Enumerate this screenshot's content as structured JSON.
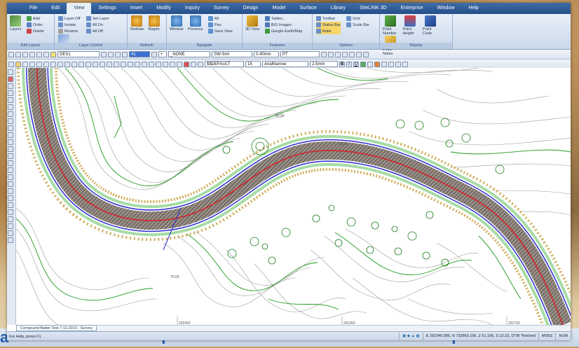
{
  "menu": {
    "items": [
      "File",
      "Edit",
      "View",
      "Settings",
      "Insert",
      "Modify",
      "Inquiry",
      "Survey",
      "Design",
      "Model",
      "Surface",
      "Library",
      "SiteLINK 3D",
      "Enterprise",
      "Window",
      "Help"
    ],
    "active_index": 2
  },
  "ribbon": {
    "groups": [
      {
        "label": "Edit Layers",
        "big": [
          {
            "label": "Layers",
            "icon": "layers-icon"
          }
        ],
        "small": [
          {
            "label": "Add",
            "icon": "add-icon"
          },
          {
            "label": "Order",
            "icon": "order-icon"
          },
          {
            "label": "Delete",
            "icon": "delete-icon"
          }
        ]
      },
      {
        "label": "Layer Control",
        "small": [
          {
            "label": "Layer Off",
            "icon": "layer-off-icon"
          },
          {
            "label": "Isolate",
            "icon": "isolate-icon"
          },
          {
            "label": "Restore",
            "icon": "restore-icon"
          }
        ],
        "small2": [
          {
            "label": "Set Layer",
            "icon": "set-layer-icon"
          },
          {
            "label": "All On",
            "icon": "all-on-icon"
          },
          {
            "label": "All Off",
            "icon": "all-off-icon"
          }
        ],
        "big": [
          {
            "label": "Groups",
            "icon": "groups-icon"
          }
        ]
      },
      {
        "label": "Refresh",
        "big": [
          {
            "label": "Redraw",
            "icon": "redraw-icon"
          },
          {
            "label": "Regen",
            "icon": "regen-icon"
          }
        ]
      },
      {
        "label": "Navigate",
        "big": [
          {
            "label": "Window",
            "icon": "window-icon"
          },
          {
            "label": "Previous",
            "icon": "previous-icon"
          }
        ],
        "small": [
          {
            "label": "All",
            "icon": "zoom-all-icon"
          },
          {
            "label": "Pan",
            "icon": "pan-icon"
          },
          {
            "label": "Save View",
            "icon": "save-view-icon"
          }
        ]
      },
      {
        "label": "Features",
        "big": [
          {
            "label": "3D View",
            "icon": "3d-view-icon"
          }
        ],
        "small": [
          {
            "label": "Tables...",
            "icon": "tables-icon"
          },
          {
            "label": "B/G Images",
            "icon": "bg-images-icon"
          },
          {
            "label": "Google Earth/Map",
            "icon": "google-earth-icon"
          }
        ]
      },
      {
        "label": "Options",
        "small": [
          {
            "label": "Toolbar",
            "icon": "toolbar-icon"
          },
          {
            "label": "Status Bar",
            "icon": "status-bar-icon"
          },
          {
            "label": "Ruler",
            "icon": "ruler-icon"
          }
        ],
        "small2": [
          {
            "label": "Grid",
            "icon": "grid-icon"
          },
          {
            "label": "Scale Bar",
            "icon": "scale-bar-icon"
          }
        ]
      },
      {
        "label": "Display",
        "big": [
          {
            "label": "Point Number",
            "icon": "point-number-icon"
          },
          {
            "label": "Point Height",
            "icon": "point-height-icon"
          },
          {
            "label": "Point Code",
            "icon": "point-code-icon"
          },
          {
            "label": "Point Notes",
            "icon": "point-notes-icon"
          }
        ]
      }
    ]
  },
  "toolbar1": {
    "layer_combo": "DES1",
    "number_combo": "41",
    "none_combo": "_NONE",
    "linetype_combo": "SW-Sml",
    "width_combo": "0.40mm",
    "pt_combo": "PT"
  },
  "toolbar2": {
    "style_combo": "$$DEFAULT",
    "size_combo": "15",
    "font_combo": "ArialNarrow",
    "height_combo": "2.5mm",
    "bold": "B",
    "italic": "I",
    "underline": "U"
  },
  "drawing": {
    "tab_label": "Compound Batter Test 7-11-2013 - Survey",
    "contour_labels": [
      "292400",
      "291300",
      "292700",
      "80.00",
      "89.00",
      "79.00"
    ]
  },
  "status": {
    "help": "For Help, press F1",
    "coords": "E 292340.585, N 732863.195, Z 61.106, S 10.32, DTM *finished",
    "mode": "MSNZ",
    "num": "NUM"
  },
  "colors": {
    "road_center": "#d4222a",
    "road_edge": "#2b2bd0",
    "hatch": "#333333",
    "contour": "#808080",
    "index_contour": "#1f9a1f",
    "batter": "#c9a040",
    "menubar": "#2d5b96"
  },
  "background_text": [
    "a",
    "Y",
    "Y"
  ]
}
